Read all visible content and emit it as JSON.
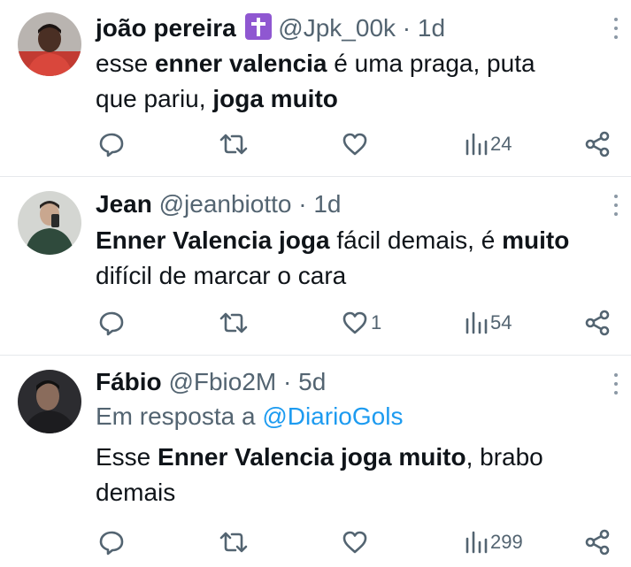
{
  "tweets": [
    {
      "name": "joão pereira",
      "handle": "@Jpk_00k",
      "dot": "·",
      "time": "1d",
      "emoji_icon": "latin-cross-emoji",
      "body_parts": [
        "esse ",
        "enner valencia",
        " é uma praga, puta",
        "que pariu, ",
        "joga muito"
      ],
      "likes": "",
      "views": "24"
    },
    {
      "name": "Jean",
      "handle": "@jeanbiotto",
      "dot": "·",
      "time": "1d",
      "body_parts": [
        "Enner Valencia joga",
        " fácil demais, é ",
        "muito",
        "difícil de marcar o cara"
      ],
      "likes": "1",
      "views": "54"
    },
    {
      "name": "Fábio",
      "handle": "@Fbio2M",
      "dot": "·",
      "time": "5d",
      "reply_prefix": "Em resposta a ",
      "reply_handle": "@DiarioGols",
      "body_parts": [
        "Esse ",
        "Enner Valencia joga muito",
        ", brabo",
        "demais"
      ],
      "likes": "",
      "views": "299"
    }
  ],
  "colors": {
    "text": "#0f1419",
    "secondary": "#536471",
    "link": "#1d9bf0",
    "divider": "#e6e9ec",
    "emoji_bg": "#8f57d1"
  }
}
